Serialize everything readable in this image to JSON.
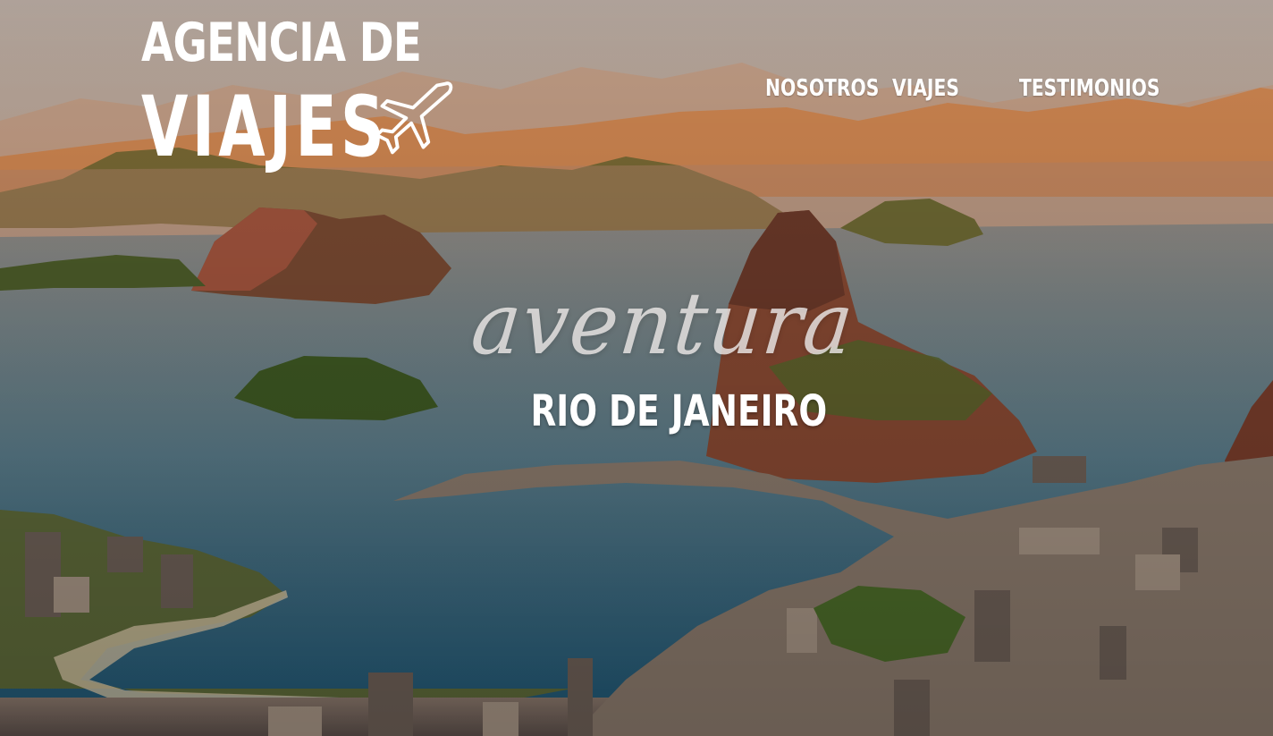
{
  "logo": {
    "line1": "AGENCIA DE",
    "line2": "VIAJES",
    "icon": "airplane-icon"
  },
  "nav": {
    "items": [
      {
        "label": "NOSOTROS"
      },
      {
        "label": "VIAJES"
      },
      {
        "label": "TESTIMONIOS"
      }
    ]
  },
  "hero": {
    "script_text": "aventura",
    "subtitle": "RIO DE JANEIRO"
  },
  "colors": {
    "text": "#ffffff",
    "sky": "#c9b9ad",
    "sunset": "#d9873e",
    "water": "#1f5f7a",
    "vegetation": "#4f6b2a"
  }
}
